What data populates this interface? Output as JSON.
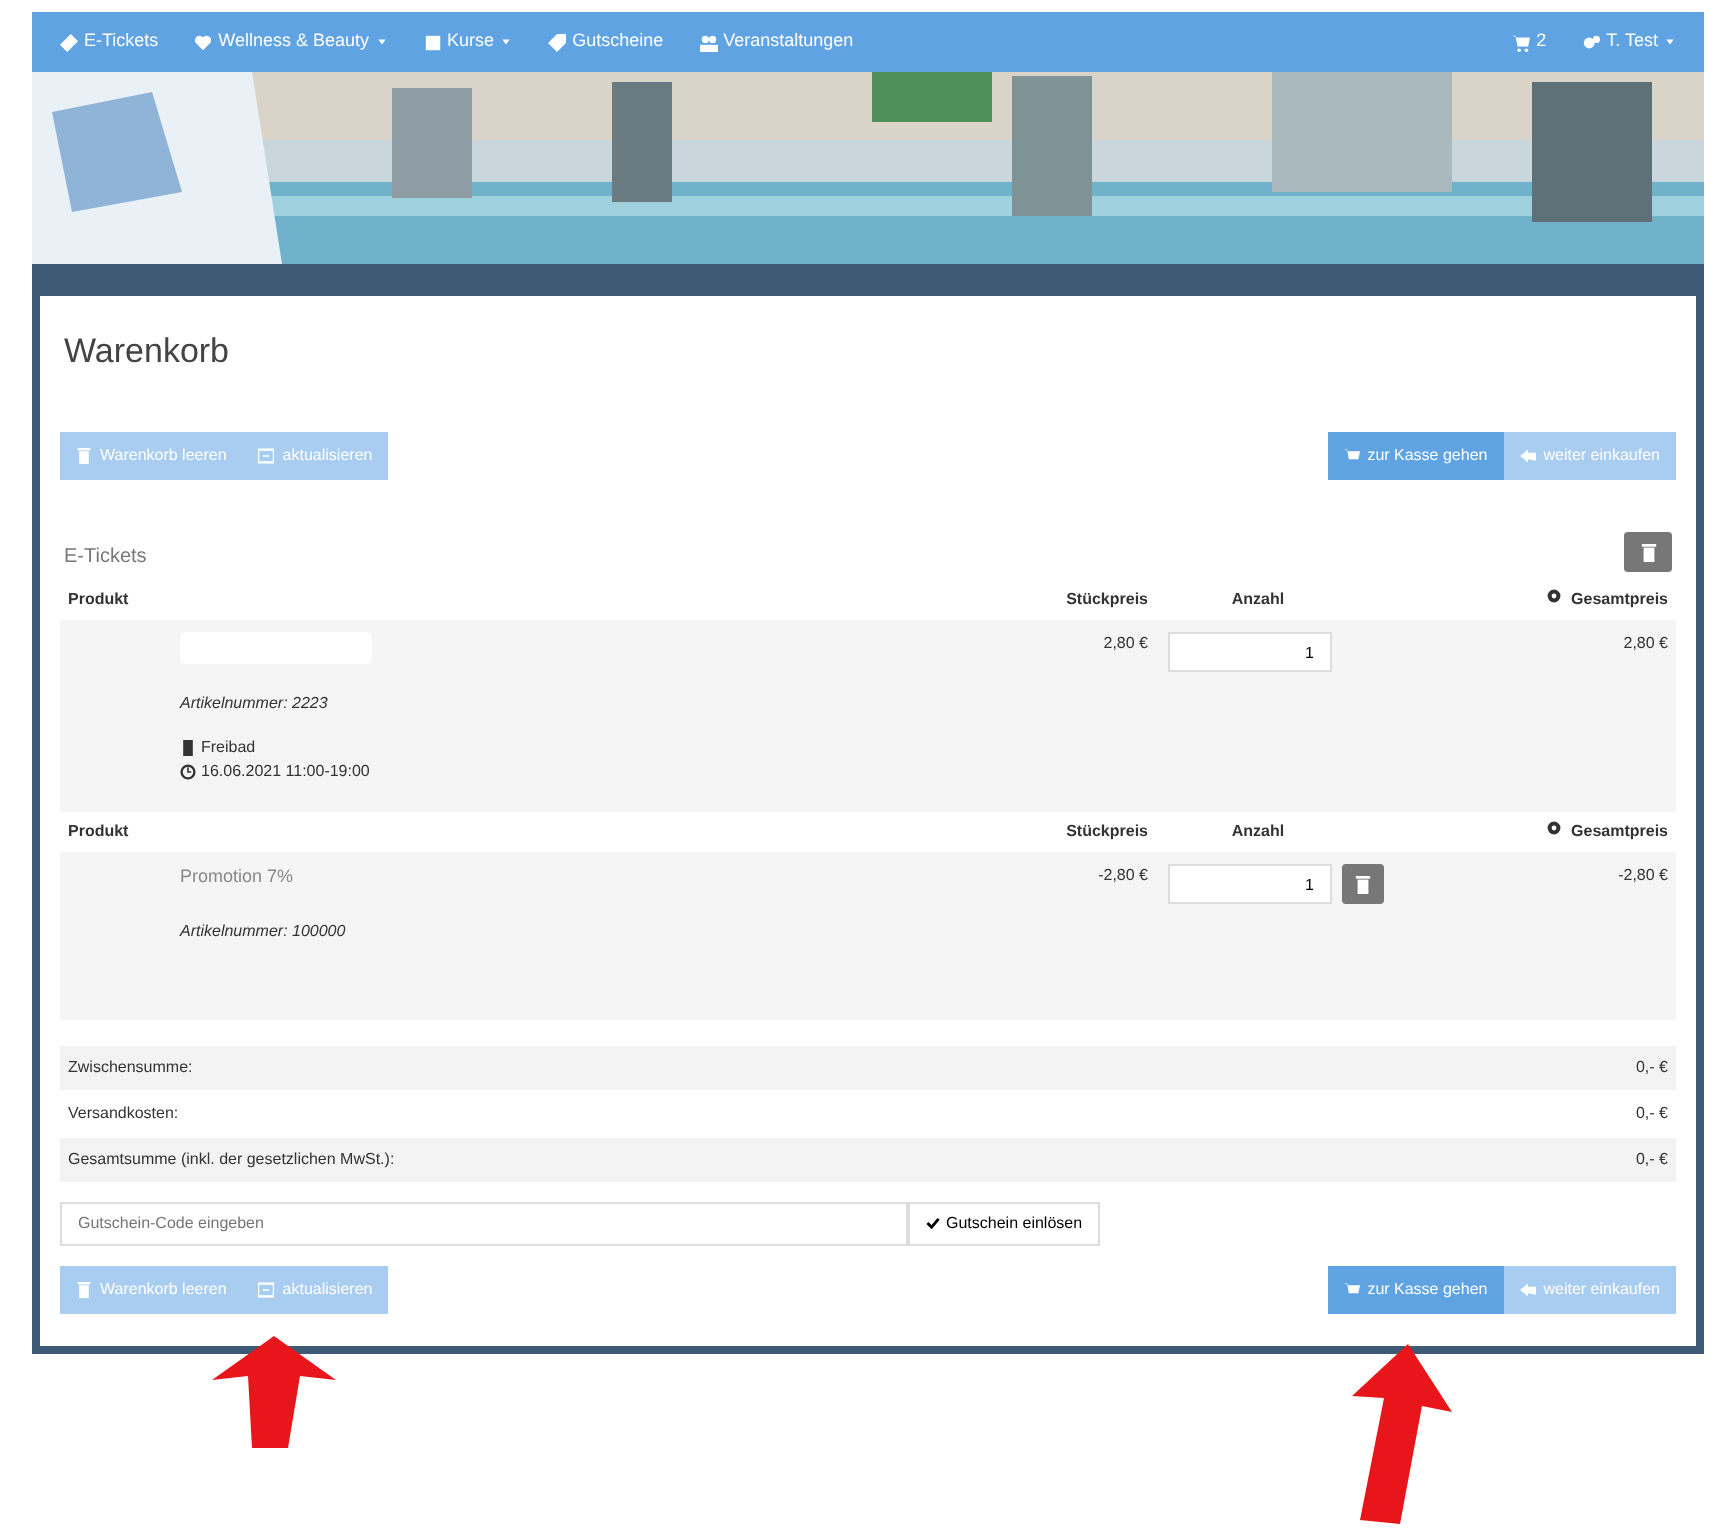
{
  "nav": {
    "items": [
      {
        "label": "E-Tickets",
        "dropdown": false
      },
      {
        "label": "Wellness & Beauty",
        "dropdown": true
      },
      {
        "label": "Kurse",
        "dropdown": true
      },
      {
        "label": "Gutscheine",
        "dropdown": false
      },
      {
        "label": "Veranstaltungen",
        "dropdown": false
      }
    ],
    "cart_count": "2",
    "user": "T. Test"
  },
  "title": "Warenkorb",
  "top_actions": {
    "left": [
      "Warenkorb leeren",
      "aktualisieren"
    ],
    "right": [
      "zur Kasse gehen",
      "weiter einkaufen"
    ]
  },
  "section": "E-Tickets",
  "groups": [
    {
      "columns": [
        "Produkt",
        "Stückpreis",
        "Anzahl",
        "Gesamtpreis"
      ],
      "article": "Artikelnummer: 2223",
      "location": "Freibad",
      "datetime": "16.06.2021 11:00-19:00",
      "unit_price": "2,80 €",
      "quantity": "1",
      "total": "2,80 €",
      "removable": false
    },
    {
      "columns": [
        "Produkt",
        "Stückpreis",
        "Anzahl",
        "Gesamtpreis"
      ],
      "product": "Promotion 7%",
      "article": "Artikelnummer: 100000",
      "unit_price": "-2,80 €",
      "quantity": "1",
      "total": "-2,80 €",
      "removable": true
    }
  ],
  "totals": [
    {
      "label": "Zwischensumme:",
      "value": "0,- €"
    },
    {
      "label": "Versandkosten:",
      "value": "0,- €"
    },
    {
      "label": "Gesamtsumme (inkl. der gesetzlichen MwSt.):",
      "value": "0,- €"
    }
  ],
  "voucher": {
    "placeholder": "Gutschein-Code eingeben",
    "button": "Gutschein einlösen"
  },
  "bottom_actions": {
    "left": [
      "Warenkorb leeren",
      "aktualisieren"
    ],
    "right": [
      "zur Kasse gehen",
      "weiter einkaufen"
    ]
  }
}
